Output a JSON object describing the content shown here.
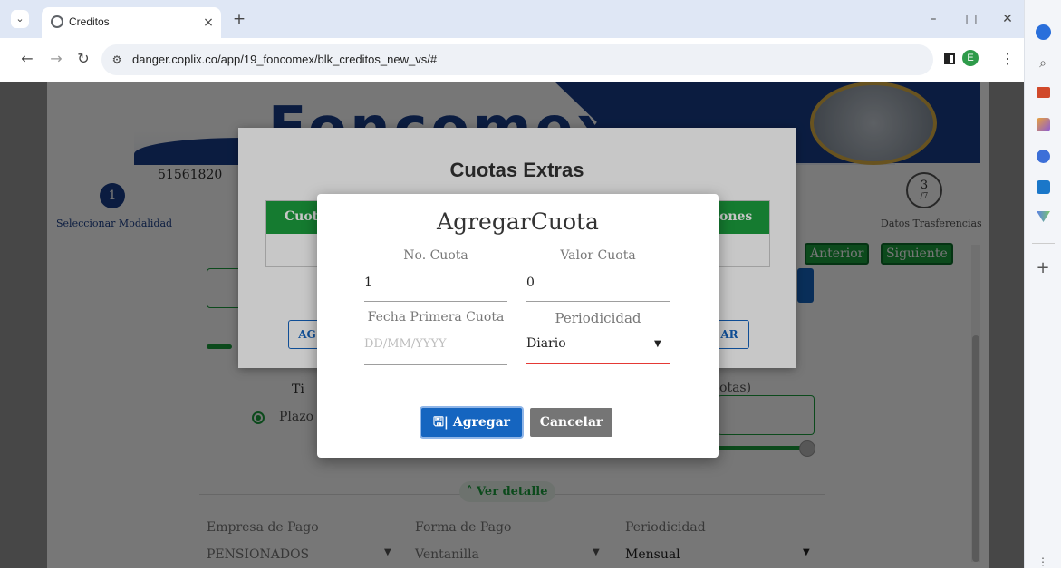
{
  "browser": {
    "tab_title": "Creditos",
    "tab_close": "×",
    "new_tab": "+",
    "url": "danger.coplix.co/app/19_foncomex/blk_creditos_new_vs/#",
    "profile_initial": "E",
    "window_min": "–",
    "window_max": "□",
    "window_close": "✕"
  },
  "page": {
    "brand": "Foncomex",
    "client_id": "51561820",
    "steps": {
      "step1_num": "1",
      "step1_label": "Seleccionar Modalidad",
      "step3_num": "3",
      "step3_den": "/7",
      "step3_label": "Datos Trasferencias"
    },
    "nav": {
      "prev": "Anterior",
      "next": "Siguiente"
    },
    "partial_labels": {
      "ti": "Ti",
      "cuotas": "uotas)"
    },
    "plazo_label": "Plazo",
    "ver_detalle": "Ver detalle",
    "details": {
      "empresa_label": "Empresa de Pago",
      "empresa_value": "PENSIONADOS",
      "forma_label": "Forma de Pago",
      "forma_value": "Ventanilla",
      "periodicidad_label": "Periodicidad",
      "periodicidad_value": "Mensual"
    }
  },
  "cuotas_modal": {
    "title": "Cuotas Extras",
    "col_left": "Cuot",
    "col_right": "ones",
    "btn_left": "AG",
    "btn_right": "AR"
  },
  "agregar_modal": {
    "title": "AgregarCuota",
    "no_cuota_label": "No. Cuota",
    "no_cuota_value": "1",
    "valor_label": "Valor Cuota",
    "valor_value": "0",
    "fecha_label": "Fecha Primera Cuota",
    "fecha_placeholder": "DD/MM/YYYY",
    "periodicidad_label": "Periodicidad",
    "periodicidad_value": "Diario",
    "btn_agregar": "| Agregar",
    "btn_cancelar": "Cancelar"
  },
  "colors": {
    "primary_blue": "#1565c0",
    "green": "#1b9e3e",
    "error_red": "#e53935",
    "cancel_gray": "#757575"
  }
}
